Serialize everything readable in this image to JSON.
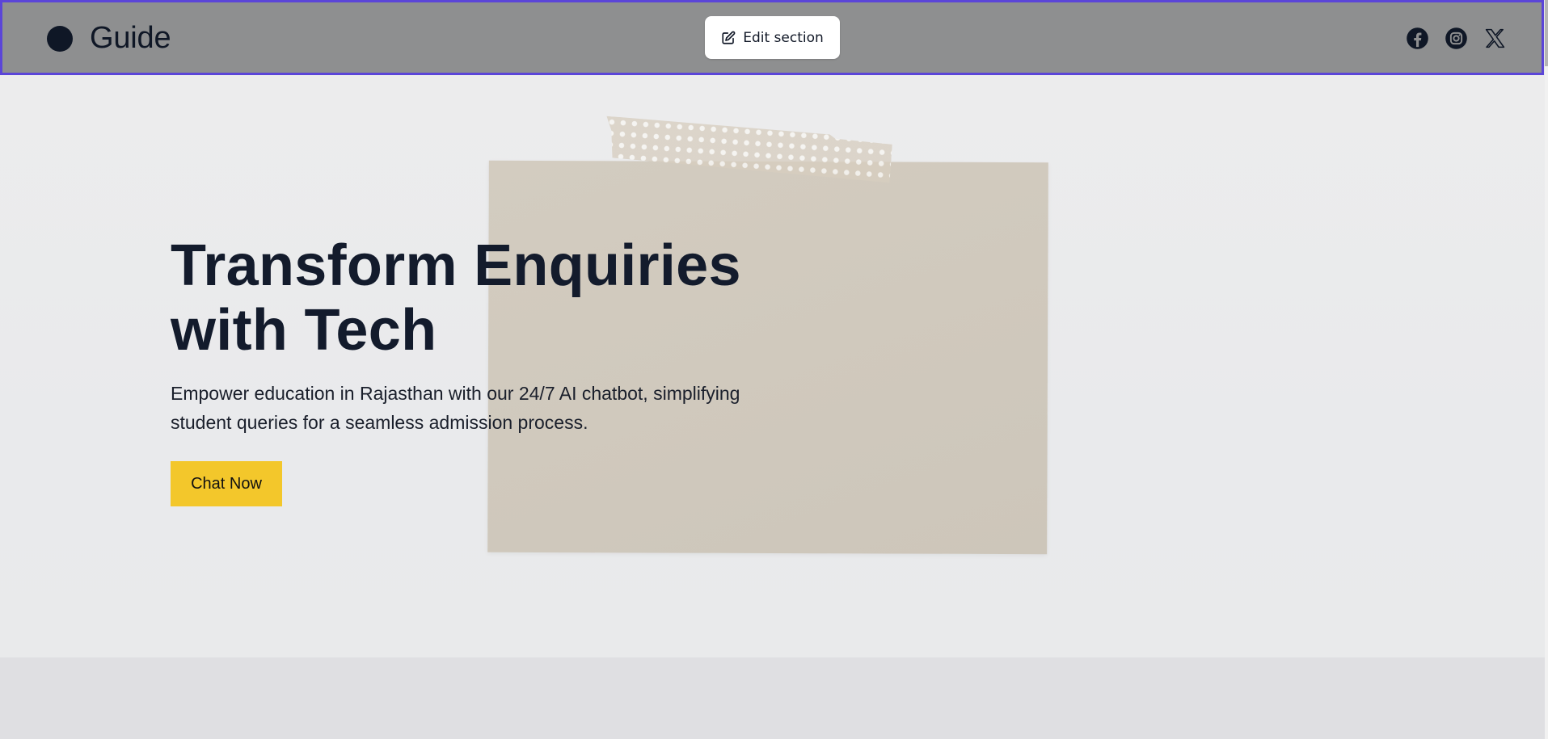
{
  "header": {
    "brand_name": "Guide",
    "edit_label": "Edit section",
    "socials": [
      {
        "icon": "facebook-icon"
      },
      {
        "icon": "instagram-icon"
      },
      {
        "icon": "x-icon"
      }
    ]
  },
  "hero": {
    "title_line1": "Transform Enquiries",
    "title_line2": "with Tech",
    "description_line1": "Empower education in Rajasthan with our 24/7 AI chatbot, simplifying",
    "description_line2": "student queries for a seamless admission process.",
    "cta_label": "Chat Now"
  },
  "colors": {
    "header_bg": "#8e8f90",
    "selection_border": "#5b45d8",
    "cta": "#f3c72b",
    "text_dark": "#131b2c"
  }
}
